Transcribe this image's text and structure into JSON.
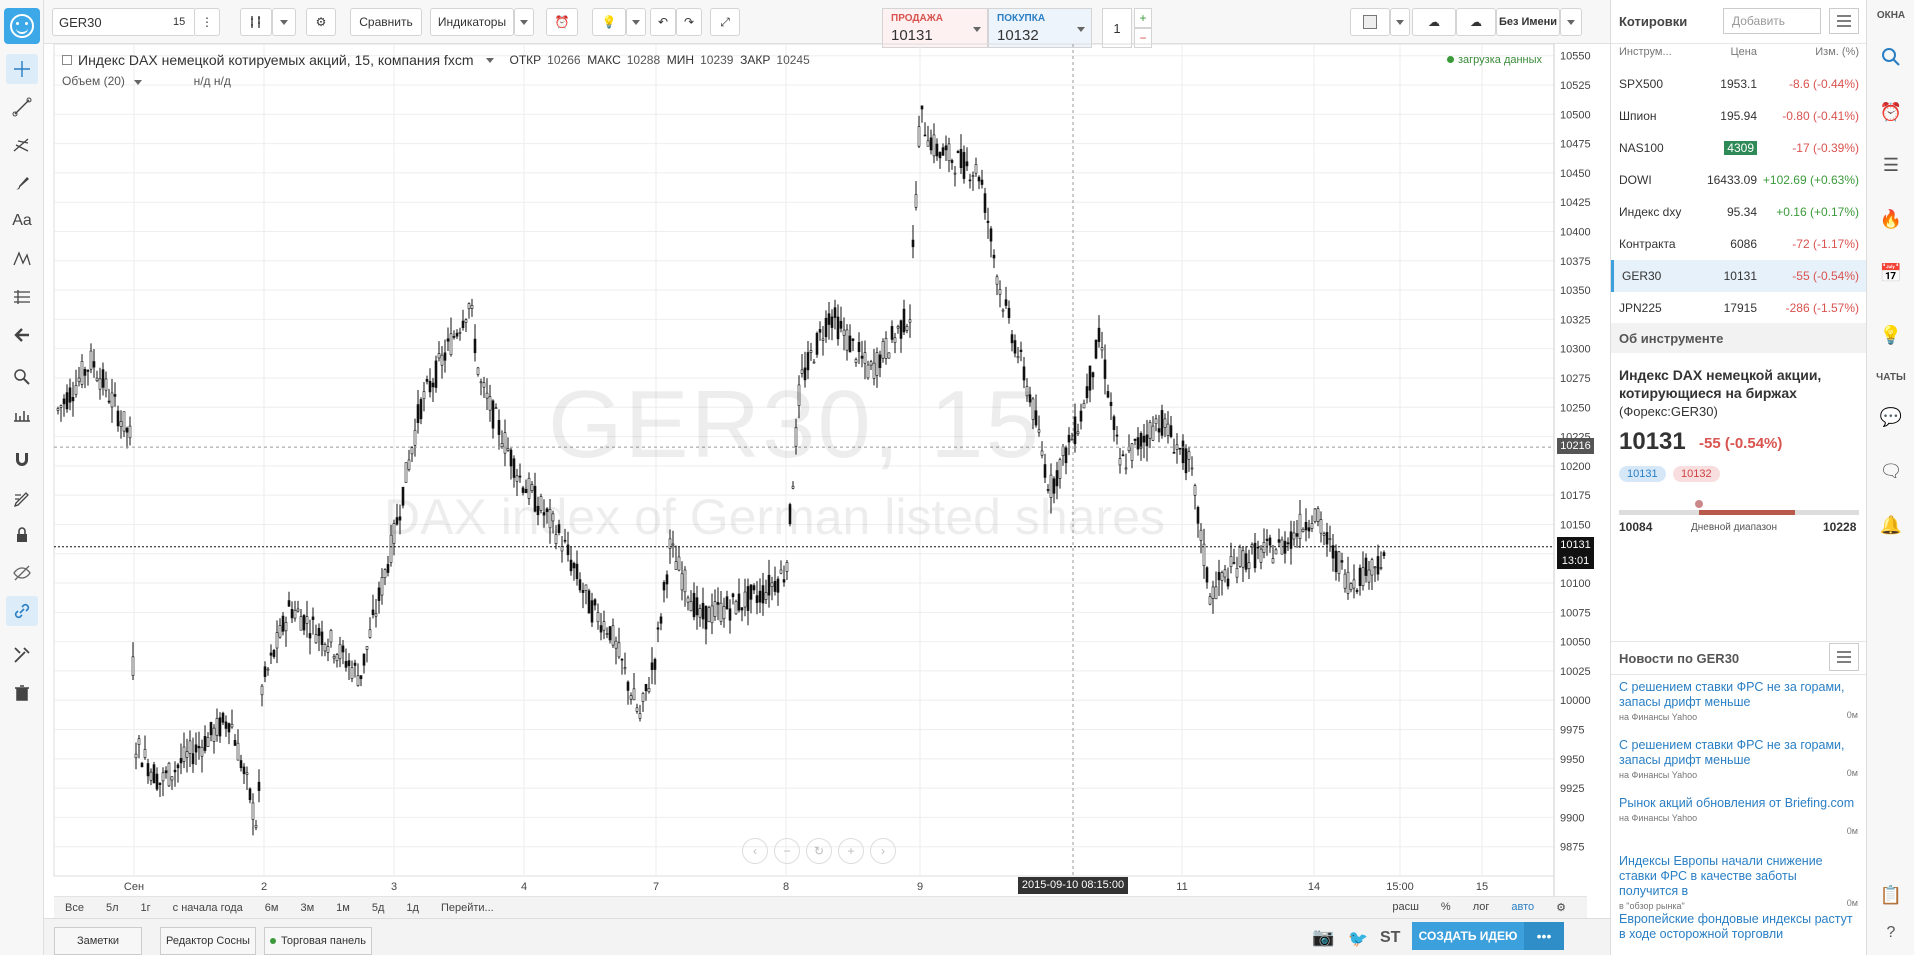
{
  "top_bar": {
    "symbol": "GER30",
    "interval": "15",
    "compare_label": "Сравнить",
    "indicators_label": "Индикаторы",
    "sell_label": "ПРОДАЖА",
    "sell_value": "10131",
    "buy_label": "ПОКУПКА",
    "buy_value": "10132",
    "quantity": "1",
    "layout_name": "Без Имени"
  },
  "legend": {
    "title": "Индекс DAX немецкой котируемых акций, 15, компания fxcm",
    "open_label": "ОТКР",
    "open": "10266",
    "high_label": "МАКС",
    "high": "10288",
    "low_label": "МИН",
    "low": "10239",
    "close_label": "ЗАКР",
    "close": "10245",
    "volume_label": "Объем (20)",
    "volume_values": "н/д  н/д",
    "loading": "загрузка данных"
  },
  "watermark": {
    "line1": "GER30, 15",
    "line2": "DAX index of German listed shares"
  },
  "chart_data": {
    "type": "candlestick",
    "price_ticks": [
      10550,
      10525,
      10500,
      10475,
      10450,
      10425,
      10400,
      10375,
      10350,
      10325,
      10300,
      10275,
      10250,
      10225,
      10200,
      10175,
      10150,
      10125,
      10100,
      10075,
      10050,
      10025,
      10000,
      9975,
      9950,
      9925,
      9900,
      9875
    ],
    "time_ticks": [
      "Сен",
      "2",
      "3",
      "4",
      "7",
      "8",
      "9",
      "11",
      "14",
      "15:00",
      "15"
    ],
    "last_price": "10131",
    "countdown": "13:01",
    "crosshair_price": "10216",
    "crosshair_time": "2015-09-10 08:15:00",
    "ylim": [
      9850,
      10560
    ]
  },
  "range_bar": {
    "items": [
      "Все",
      "5л",
      "1г",
      "с начала года",
      "6м",
      "3м",
      "1м",
      "5д",
      "1д",
      "Перейти..."
    ],
    "right_items": [
      "расш",
      "%",
      "лог",
      "авто"
    ]
  },
  "bottom_bar": {
    "notes": "Заметки",
    "pine_editor": "Редактор Сосны",
    "trading_panel": "Торговая панель",
    "publish_idea": "СОЗДАТЬ ИДЕЮ",
    "more": "•••",
    "stocktwits": "ST"
  },
  "watchlist": {
    "title": "Котировки",
    "add_placeholder": "Добавить",
    "col_symbol": "Инструм...",
    "col_price": "Цена",
    "col_change": "Изм. (%)",
    "rows": [
      {
        "symbol": "SPX500",
        "price": "1953.1",
        "change": "-8.6 (-0.44%)"
      },
      {
        "symbol": "Шпион",
        "price": "195.94",
        "change": "-0.80 (-0.41%)"
      },
      {
        "symbol": "NAS100",
        "price": "4309",
        "change": "-17 (-0.39%)"
      },
      {
        "symbol": "DOWI",
        "price": "16433.09",
        "change": "+102.69 (+0.63%)"
      },
      {
        "symbol": "Индекс dxy",
        "price": "95.34",
        "change": "+0.16 (+0.17%)"
      },
      {
        "symbol": "Контракта",
        "price": "6086",
        "change": "-72 (-1.17%)"
      },
      {
        "symbol": "GER30",
        "price": "10131",
        "change": "-55 (-0.54%)"
      },
      {
        "symbol": "JPN225",
        "price": "17915",
        "change": "-286 (-1.57%)"
      }
    ]
  },
  "details": {
    "section_title": "Об инструменте",
    "name": "Индекс DAX немецкой акции, котирующиеся на биржах",
    "exchange": "(Форекс:GER30)",
    "price": "10131",
    "change": "-55 (-0.54%)",
    "bid": "10131",
    "ask": "10132",
    "range_low": "10084",
    "range_high": "10228",
    "range_label": "Дневной диапазон"
  },
  "news": {
    "title": "Новости по GER30",
    "items": [
      {
        "headline": "С решением ставки ФРС не за горами, запасы дрифт меньше",
        "source": "на Финансы Yahoo",
        "time": "0м"
      },
      {
        "headline": "С решением ставки ФРС не за горами, запасы дрифт меньше",
        "source": "на Финансы Yahoo",
        "time": "0м"
      },
      {
        "headline": "Рынок акций обновления от Briefing.com",
        "source": "на Финансы Yahoo",
        "time": "0м"
      },
      {
        "headline": "Индексы Европы начали снижение ставки ФРС в качестве заботы получится в",
        "source": "в \"обзор рынка\"",
        "time": "0м"
      },
      {
        "headline": "Европейские фондовые индексы растут в ходе осторожной торговли",
        "source": "",
        "time": ""
      }
    ]
  },
  "far_right": {
    "windows_label": "ОКНА",
    "chats_label": "ЧАТЫ"
  }
}
